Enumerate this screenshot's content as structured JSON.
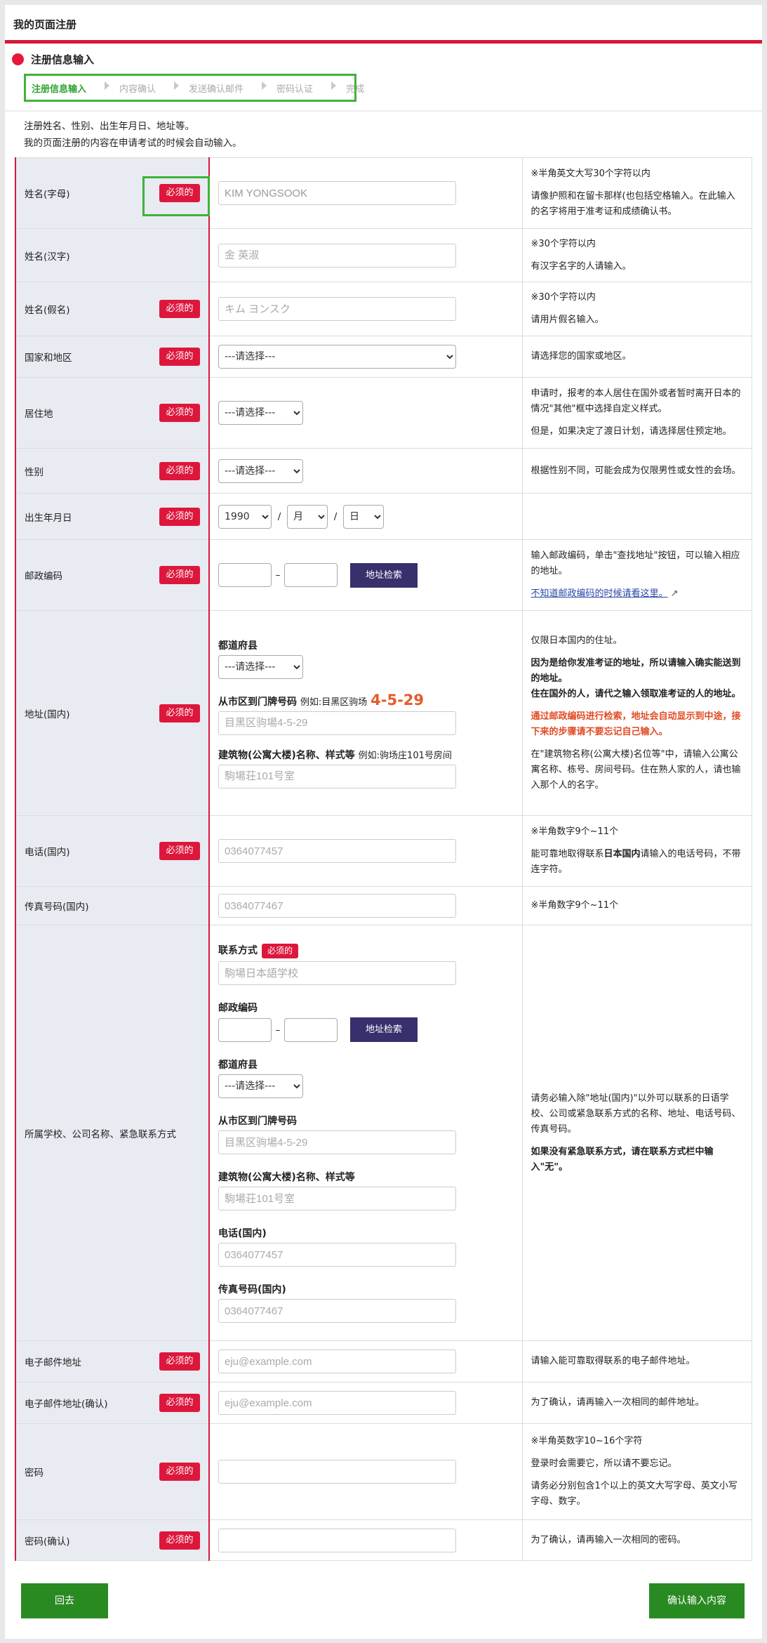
{
  "page_title": "我的页面注册",
  "section_title": "注册信息输入",
  "steps": [
    "注册信息输入",
    "内容确认",
    "发送确认邮件",
    "密码认证",
    "完成"
  ],
  "intro": [
    "注册姓名、性别、出生年月日、地址等。",
    "我的页面注册的内容在申请考试的时候会自动输入。"
  ],
  "required_label": "必须的",
  "address_search_label": "地址检索",
  "select_placeholder": "---请选择---",
  "rows": {
    "name_alpha": {
      "label": "姓名(字母)",
      "value": "KIM YONGSOOK",
      "note1": "※半角英文大写30个字符以内",
      "note2": "请像护照和在留卡那样(也包括空格输入。在此输入的名字将用于准考证和成绩确认书。"
    },
    "name_kanji": {
      "label": "姓名(汉字)",
      "placeholder": "金 英淑",
      "note1": "※30个字符以内",
      "note2": "有汉字名字的人请输入。"
    },
    "name_kana": {
      "label": "姓名(假名)",
      "placeholder": "キム ヨンスク",
      "note1": "※30个字符以内",
      "note2": "请用片假名输入。"
    },
    "country": {
      "label": "国家和地区",
      "select": "---请选择---",
      "note": "请选择您的国家或地区。"
    },
    "residence": {
      "label": "居住地",
      "select": "---请选择---",
      "note1": "申请时，报考的本人居住在国外或者暂时离开日本的情况\"其他\"框中选择自定义样式。",
      "note2": "但是，如果决定了渡日计划，请选择居住预定地。"
    },
    "gender": {
      "label": "性别",
      "select": "---请选择---",
      "note": "根据性别不同，可能会成为仅限男性或女性的会场。"
    },
    "birth": {
      "label": "出生年月日",
      "year": "1990",
      "month": "月",
      "day": "日"
    },
    "postal": {
      "label": "邮政编码",
      "note1": "输入邮政编码，单击\"查找地址\"按钮，可以输入相应的地址。",
      "link": "不知道邮政编码的时候请看这里。"
    },
    "address": {
      "label": "地址(国内)",
      "pref_label": "都道府县",
      "city_label": "从市区到门牌号码",
      "city_example": "例如:目黑区驹场",
      "city_example_big": "4-5-29",
      "city_placeholder": "目黑区驹場4-5-29",
      "bldg_label": "建筑物(公寓大楼)名称、样式等",
      "bldg_example": "例如:驹场庄101号房间",
      "bldg_placeholder": "駒場荘101号室",
      "note1": "仅限日本国内的住址。",
      "note2": "因为是给你发准考证的地址，所以请输入确实能送到的地址。",
      "note3": "住在国外的人，请代之输入领取准考证的人的地址。",
      "note4": "通过邮政编码进行检索，地址会自动显示到中途，接下来的步骤请不要忘记自己输入。",
      "note5": "在\"建筑物名称(公寓大楼)名位等\"中，请输入公寓公寓名称、栋号、房间号码。住在熟人家的人，请也输入那个人的名字。"
    },
    "phone": {
      "label": "电话(国内)",
      "placeholder": "0364077457",
      "note1": "※半角数字9个~11个",
      "note2a": "能可靠地取得联系",
      "note2b": "日本国内",
      "note2c": "请输入的电话号码，不带连字符。"
    },
    "fax": {
      "label": "传真号码(国内)",
      "placeholder": "0364077467",
      "note": "※半角数字9个~11个"
    },
    "contact": {
      "label": "所属学校、公司名称、紧急联系方式",
      "contact_label": "联系方式",
      "contact_placeholder": "駒場日本語学校",
      "postal_label": "邮政编码",
      "pref_label": "都道府县",
      "city_label": "从市区到门牌号码",
      "city_placeholder": "目黑区驹場4-5-29",
      "bldg_label": "建筑物(公寓大楼)名称、样式等",
      "bldg_placeholder": "駒場荘101号室",
      "phone_label": "电话(国内)",
      "phone_placeholder": "0364077457",
      "fax_label": "传真号码(国内)",
      "fax_placeholder": "0364077467",
      "note1": "请务必输入除\"地址(国内)\"以外可以联系的日语学校、公司或紧急联系方式的名称、地址、电话号码、传真号码。",
      "note2": "如果没有紧急联系方式，请在联系方式栏中输入\"无\"。"
    },
    "email": {
      "label": "电子邮件地址",
      "placeholder": "eju@example.com",
      "note": "请输入能可靠取得联系的电子邮件地址。"
    },
    "email_confirm": {
      "label": "电子邮件地址(确认)",
      "placeholder": "eju@example.com",
      "note": "为了确认，请再输入一次相同的邮件地址。"
    },
    "password": {
      "label": "密码",
      "note1": "※半角英数字10~16个字符",
      "note2": "登录时会需要它，所以请不要忘记。",
      "note3": "请务必分别包含1个以上的英文大写字母、英文小写字母、数字。"
    },
    "password_confirm": {
      "label": "密码(确认)",
      "note": "为了确认，请再输入一次相同的密码。"
    }
  },
  "back_label": "回去",
  "confirm_label": "确认输入内容",
  "colors": {
    "accent": "#d6173d",
    "green": "#2a8a22",
    "navy": "#38306d",
    "highlight": "#3fb339"
  }
}
